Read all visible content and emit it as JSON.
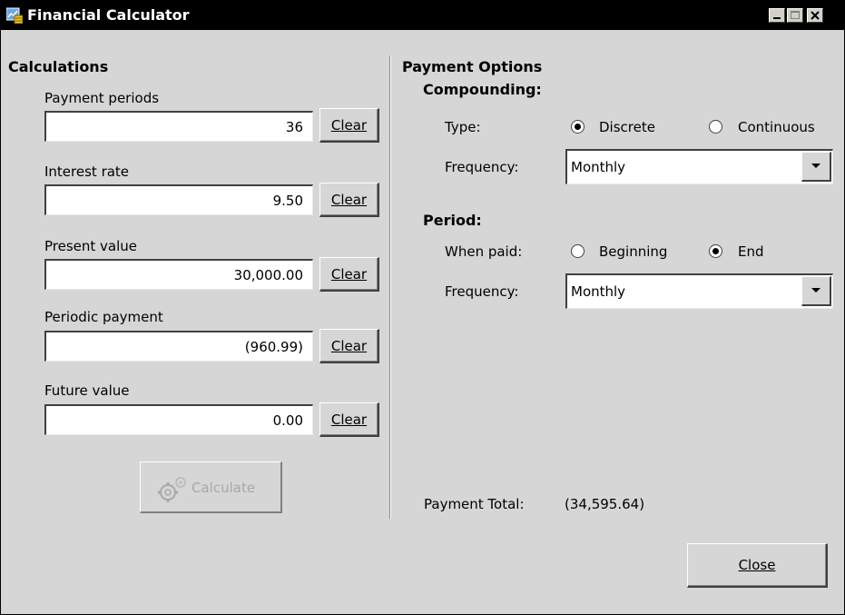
{
  "window": {
    "title": "Financial Calculator"
  },
  "calculations": {
    "heading": "Calculations",
    "fields": [
      {
        "label": "Payment periods",
        "value": "36",
        "clear": "Clear"
      },
      {
        "label": "Interest rate",
        "value": "9.50",
        "clear": "Clear"
      },
      {
        "label": "Present value",
        "value": "30,000.00",
        "clear": "Clear"
      },
      {
        "label": "Periodic payment",
        "value": "(960.99)",
        "clear": "Clear"
      },
      {
        "label": "Future value",
        "value": "0.00",
        "clear": "Clear"
      }
    ],
    "calculate_label": "Calculate"
  },
  "payment_options": {
    "heading": "Payment Options",
    "compounding": {
      "heading": "Compounding:",
      "type_label": "Type:",
      "type_options": [
        "Discrete",
        "Continuous"
      ],
      "type_selected": "Discrete",
      "frequency_label": "Frequency:",
      "frequency_value": "Monthly"
    },
    "period": {
      "heading": "Period:",
      "when_label": "When paid:",
      "when_options": [
        "Beginning",
        "End"
      ],
      "when_selected": "End",
      "frequency_label": "Frequency:",
      "frequency_value": "Monthly"
    },
    "total_label": "Payment Total:",
    "total_value": "(34,595.64)"
  },
  "footer": {
    "close_label": "Close"
  },
  "icons": [
    "app-icon",
    "minimize-icon",
    "maximize-icon",
    "close-icon",
    "gear-icon",
    "dropdown-arrow-icon"
  ]
}
